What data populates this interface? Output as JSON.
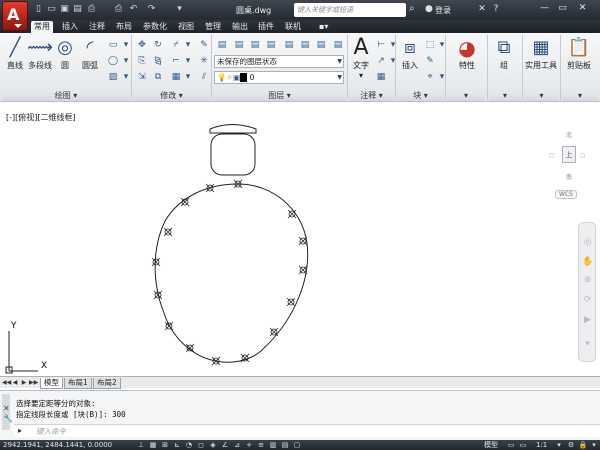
{
  "title_bar": {
    "doc_title": "圆桌.dwg",
    "search_placeholder": "键入关键字或短语",
    "login": "登录"
  },
  "ribbon_tabs": [
    "常用",
    "插入",
    "注释",
    "布局",
    "参数化",
    "视图",
    "管理",
    "输出",
    "插件",
    "联机"
  ],
  "draw_panel": {
    "tools": [
      "直线",
      "多段线",
      "圆",
      "圆弧"
    ],
    "title": "绘图"
  },
  "modify_panel": {
    "title": "修改"
  },
  "layer_panel": {
    "title": "图层",
    "layer_state": "未保存的图层状态",
    "current_layer": "0"
  },
  "annotation_panel": {
    "title": "注释",
    "text_tool": "文字"
  },
  "block_panel": {
    "title": "块",
    "insert_tool": "插入"
  },
  "properties_panel": {
    "label": "特性"
  },
  "groups_panel": {
    "label": "组"
  },
  "utilities_panel": {
    "label": "实用工具"
  },
  "clipboard_panel": {
    "label": "剪贴板"
  },
  "viewport": {
    "label": "[-][俯视][二维线框]",
    "wcs": "WCS",
    "cube_top": "北",
    "cube_face": "上",
    "cube_bottom": "南",
    "ucs_x": "X",
    "ucs_y": "Y"
  },
  "layout_tabs": [
    "模型",
    "布局1",
    "布局2"
  ],
  "command": {
    "line1": "选择要定距等分的对象:",
    "line2": "指定线段长度或 [块(B)]: 300",
    "input_placeholder": "键入命令"
  },
  "status": {
    "coords": "2942.1941, 2484.1441, 0.0000",
    "model_label": "模型",
    "scale": "1:1"
  }
}
